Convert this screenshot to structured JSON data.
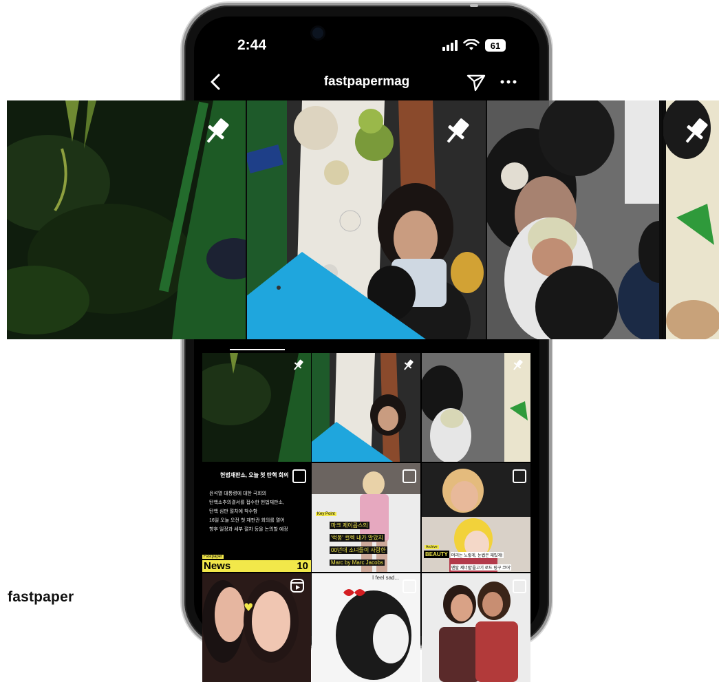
{
  "status_bar": {
    "time": "2:44",
    "battery": "61"
  },
  "nav": {
    "title": "fastpapermag"
  },
  "grid": {
    "news_post": {
      "headline": "헌법재판소, 오늘 첫 탄핵 회의",
      "lines": [
        "윤석열 대통령에 대한 국회의",
        "탄핵소추의결서를 접수한 헌법재판소,",
        "탄핵 심판 절차에 착수함",
        "16일 오늘 오전 첫 재판관 회의를 열어",
        "향후 일정과 세부 절차 등을 논의할 예정"
      ],
      "label_small": "Fastpaper",
      "label_big": "News",
      "number": "10"
    },
    "keypoint_post": {
      "tag": "Key Point",
      "lines": [
        "마크 제이콥스의",
        "'럭봄' 컬렉 내가 알았지",
        "00년대 소녀들이 사랑한",
        "Marc by Marc Jacobs"
      ]
    },
    "beauty_post": {
      "tag": "Archive",
      "logo": "BEAUTY",
      "lines": [
        "머리는 노랗게, 눈썹은 재밌게!",
        "멘탈 제너럴'을고기 로드 링구 코어'"
      ]
    },
    "row3_text": "I feel sad..."
  },
  "footer": {
    "brand": "fastpaper"
  }
}
